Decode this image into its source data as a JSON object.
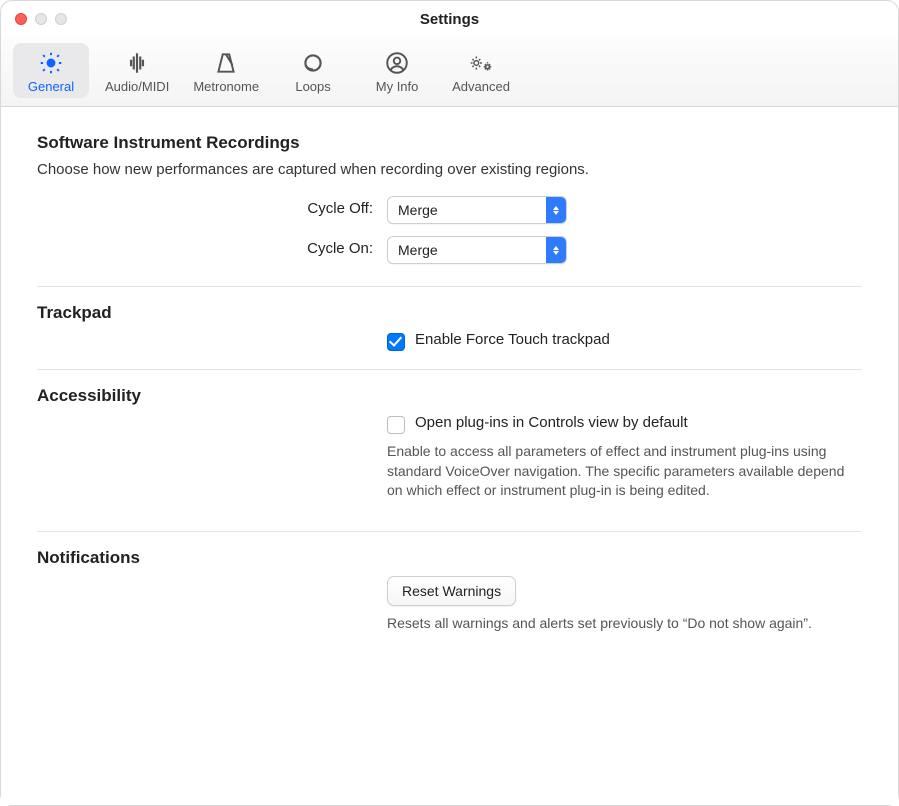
{
  "window": {
    "title": "Settings"
  },
  "toolbar": {
    "items": [
      {
        "label": "General",
        "icon": "gear-icon",
        "selected": true
      },
      {
        "label": "Audio/MIDI",
        "icon": "waveform-icon",
        "selected": false
      },
      {
        "label": "Metronome",
        "icon": "metronome-icon",
        "selected": false
      },
      {
        "label": "Loops",
        "icon": "loop-icon",
        "selected": false
      },
      {
        "label": "My Info",
        "icon": "person-icon",
        "selected": false
      },
      {
        "label": "Advanced",
        "icon": "gears-icon",
        "selected": false
      }
    ]
  },
  "sections": {
    "recordings": {
      "heading": "Software Instrument Recordings",
      "description": "Choose how new performances are captured when recording over existing regions.",
      "cycle_off_label": "Cycle Off:",
      "cycle_off_value": "Merge",
      "cycle_on_label": "Cycle On:",
      "cycle_on_value": "Merge"
    },
    "trackpad": {
      "heading": "Trackpad",
      "force_touch_label": "Enable Force Touch trackpad",
      "force_touch_checked": true
    },
    "accessibility": {
      "heading": "Accessibility",
      "plugins_label": "Open plug-ins in Controls view by default",
      "plugins_checked": false,
      "plugins_hint": "Enable to access all parameters of effect and instrument plug-ins using standard VoiceOver navigation. The specific parameters available depend on which effect or instrument plug-in is being edited."
    },
    "notifications": {
      "heading": "Notifications",
      "reset_button": "Reset Warnings",
      "reset_hint": "Resets all warnings and alerts set previously to “Do not show again”."
    }
  }
}
